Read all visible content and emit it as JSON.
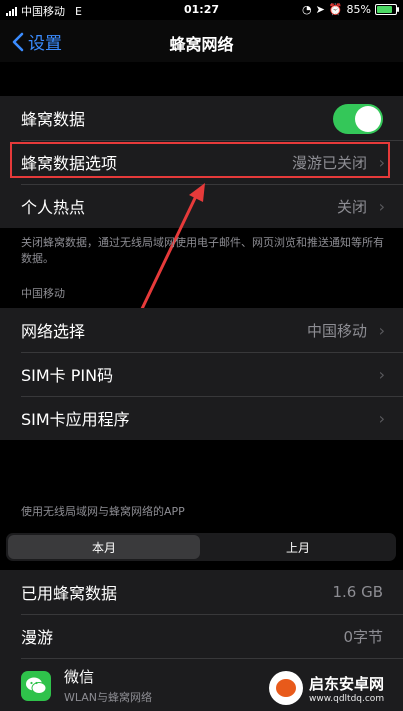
{
  "status": {
    "carrier": "中国移动",
    "network": "E",
    "time": "01:27",
    "battery": "85%",
    "battery_level": 0.85
  },
  "navbar": {
    "back_label": "设置",
    "title": "蜂窝网络"
  },
  "cellular": {
    "data_label": "蜂窝数据",
    "data_on": true,
    "options_label": "蜂窝数据选项",
    "options_value": "漫游已关闭",
    "hotspot_label": "个人热点",
    "hotspot_value": "关闭"
  },
  "note": {
    "text": "关闭蜂窝数据，通过无线局域网使用电子邮件、网页浏览和推送通知等所有数据。"
  },
  "carrier_section": {
    "header": "中国移动",
    "network_label": "网络选择",
    "network_value": "中国移动",
    "simpin_label": "SIM卡 PIN码",
    "simapp_label": "SIM卡应用程序"
  },
  "apps": {
    "header": "使用无线局域网与蜂窝网络的APP",
    "seg_current": "本月",
    "seg_previous": "上月",
    "used_label": "已用蜂窝数据",
    "used_value": "1.6 GB",
    "roaming_label": "漫游",
    "roaming_value": "0字节",
    "app_name": "微信",
    "app_sub": "WLAN与蜂窝网络"
  },
  "watermark": {
    "title": "启东安卓网",
    "url": "www.qdltdq.com"
  },
  "colors": {
    "accent": "#3b8cff",
    "toggle_on": "#34c759",
    "highlight": "#e63a3a"
  }
}
